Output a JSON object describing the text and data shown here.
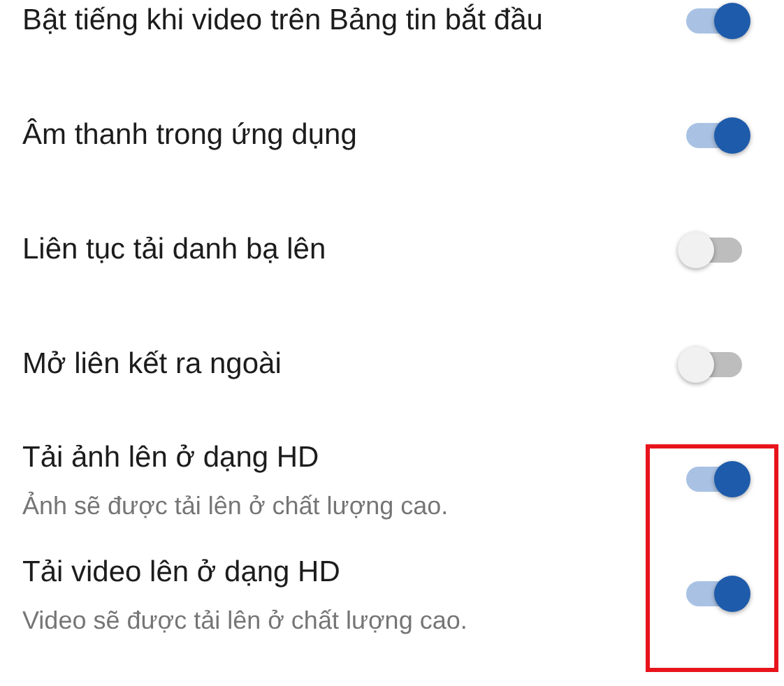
{
  "settings": [
    {
      "kind": "single",
      "title": "Bật tiếng khi video trên Bảng tin bắt đầu",
      "on": true
    },
    {
      "kind": "single",
      "title": "Âm thanh trong ứng dụng",
      "on": true
    },
    {
      "kind": "single",
      "title": "Liên tục tải danh bạ lên",
      "on": false
    },
    {
      "kind": "single",
      "title": "Mở liên kết ra ngoài",
      "on": false
    },
    {
      "kind": "detail",
      "title": "Tải ảnh lên ở dạng HD",
      "subtitle": "Ảnh sẽ được tải lên ở chất lượng cao.",
      "on": true
    },
    {
      "kind": "detail",
      "title": "Tải video lên ở dạng HD",
      "subtitle": "Video sẽ được tải lên ở chất lượng cao.",
      "on": true
    }
  ]
}
